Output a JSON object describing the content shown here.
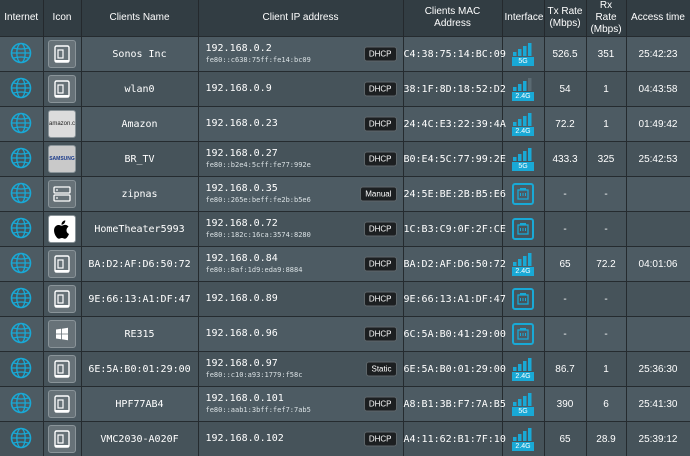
{
  "columns": [
    "Internet",
    "Icon",
    "Clients Name",
    "Client IP address",
    "Clients MAC Address",
    "Interface",
    "Tx Rate (Mbps)",
    "Rx Rate (Mbps)",
    "Access time"
  ],
  "colors": {
    "header_bg": "#323d43",
    "row_bg": "#4d5b63",
    "accent": "#19a9d6"
  },
  "rows": [
    {
      "name": "Sonos Inc",
      "ip": "192.168.0.2",
      "ipv6": "fe80::c638:75ff:fe14:bc09",
      "type": "DHCP",
      "mac": "C4:38:75:14:BC:09",
      "iface": "wifi",
      "band": "5G",
      "bars": 4,
      "tx": "526.5",
      "rx": "351",
      "time": "25:42:23",
      "icon": "generic-device-icon"
    },
    {
      "name": "wlan0",
      "ip": "192.168.0.9",
      "ipv6": "",
      "type": "DHCP",
      "mac": "38:1F:8D:18:52:D2",
      "iface": "wifi",
      "band": "2.4G",
      "bars": 3,
      "tx": "54",
      "rx": "1",
      "time": "04:43:58",
      "icon": "generic-device-icon"
    },
    {
      "name": "Amazon",
      "ip": "192.168.0.23",
      "ipv6": "",
      "type": "DHCP",
      "mac": "24:4C:E3:22:39:4A",
      "iface": "wifi",
      "band": "2.4G",
      "bars": 4,
      "tx": "72.2",
      "rx": "1",
      "time": "01:49:42",
      "icon": "amazon-logo-icon",
      "brand": "amazon.com"
    },
    {
      "name": "BR_TV",
      "ip": "192.168.0.27",
      "ipv6": "fe80::b2e4:5cff:fe77:992e",
      "type": "DHCP",
      "mac": "B0:E4:5C:77:99:2E",
      "iface": "wifi",
      "band": "5G",
      "bars": 4,
      "tx": "433.3",
      "rx": "325",
      "time": "25:42:53",
      "icon": "samsung-logo-icon",
      "brand": "SAMSUNG"
    },
    {
      "name": "zipnas",
      "ip": "192.168.0.35",
      "ipv6": "fe80::265e:beff:fe2b:b5e6",
      "type": "Manual",
      "mac": "24:5E:BE:2B:B5:E6",
      "iface": "ethernet",
      "band": "",
      "bars": 0,
      "tx": "-",
      "rx": "-",
      "time": "",
      "icon": "nas-icon"
    },
    {
      "name": "HomeTheater5993",
      "ip": "192.168.0.72",
      "ipv6": "fe80::182c:16ca:3574:8280",
      "type": "DHCP",
      "mac": "1C:B3:C9:0F:2F:CE",
      "iface": "ethernet",
      "band": "",
      "bars": 0,
      "tx": "-",
      "rx": "-",
      "time": "",
      "icon": "apple-logo-icon"
    },
    {
      "name": "BA:D2:AF:D6:50:72",
      "ip": "192.168.0.84",
      "ipv6": "fe80::8af:1d9:eda9:8884",
      "type": "DHCP",
      "mac": "BA:D2:AF:D6:50:72",
      "iface": "wifi",
      "band": "2.4G",
      "bars": 4,
      "tx": "65",
      "rx": "72.2",
      "time": "04:01:06",
      "icon": "generic-device-icon"
    },
    {
      "name": "9E:66:13:A1:DF:47",
      "ip": "192.168.0.89",
      "ipv6": "",
      "type": "DHCP",
      "mac": "9E:66:13:A1:DF:47",
      "iface": "ethernet",
      "band": "",
      "bars": 0,
      "tx": "-",
      "rx": "-",
      "time": "",
      "icon": "generic-device-icon"
    },
    {
      "name": "RE315",
      "ip": "192.168.0.96",
      "ipv6": "",
      "type": "DHCP",
      "mac": "6C:5A:B0:41:29:00",
      "iface": "ethernet",
      "band": "",
      "bars": 0,
      "tx": "-",
      "rx": "-",
      "time": "",
      "icon": "windows-logo-icon"
    },
    {
      "name": "6E:5A:B0:01:29:00",
      "ip": "192.168.0.97",
      "ipv6": "fe80::c10:a93:1779:f58c",
      "type": "Static",
      "mac": "6E:5A:B0:01:29:00",
      "iface": "wifi",
      "band": "2.4G",
      "bars": 4,
      "tx": "86.7",
      "rx": "1",
      "time": "25:36:30",
      "icon": "generic-device-icon"
    },
    {
      "name": "HPF77AB4",
      "ip": "192.168.0.101",
      "ipv6": "fe80::aab1:3bff:fef7:7ab5",
      "type": "DHCP",
      "mac": "A8:B1:3B:F7:7A:B5",
      "iface": "wifi",
      "band": "5G",
      "bars": 4,
      "tx": "390",
      "rx": "6",
      "time": "25:41:30",
      "icon": "generic-device-icon"
    },
    {
      "name": "VMC2030-A020F",
      "ip": "192.168.0.102",
      "ipv6": "",
      "type": "DHCP",
      "mac": "A4:11:62:B1:7F:10",
      "iface": "wifi",
      "band": "2.4G",
      "bars": 4,
      "tx": "65",
      "rx": "28.9",
      "time": "25:39:12",
      "icon": "generic-device-icon"
    }
  ]
}
